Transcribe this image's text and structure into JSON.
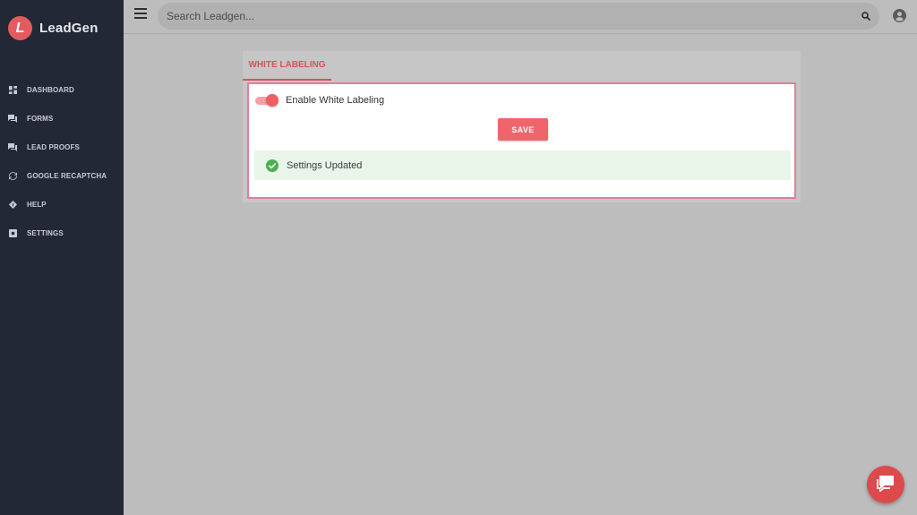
{
  "brand": {
    "logo_letter": "L",
    "name": "LeadGen",
    "color": "#e25c5f"
  },
  "sidebar": {
    "items": [
      {
        "label": "DASHBOARD",
        "icon": "dashboard-icon"
      },
      {
        "label": "FORMS",
        "icon": "forms-icon"
      },
      {
        "label": "LEAD PROOFS",
        "icon": "lead-proofs-icon"
      },
      {
        "label": "GOOGLE RECAPTCHA",
        "icon": "recaptcha-icon"
      },
      {
        "label": "HELP",
        "icon": "help-icon"
      },
      {
        "label": "SETTINGS",
        "icon": "settings-icon"
      }
    ]
  },
  "header": {
    "menu_icon": "hamburger-menu-icon",
    "search_placeholder": "Search Leadgen...",
    "search_value": "",
    "search_icon": "search-icon",
    "user_icon": "user-account-icon"
  },
  "main": {
    "tabs": [
      {
        "label": "WHITE LABELING",
        "active": true
      }
    ],
    "toggle": {
      "label": "Enable White Labeling",
      "enabled": true
    },
    "save_label": "SAVE",
    "alert": {
      "icon": "check-circle-icon",
      "text": "Settings Updated",
      "color": "#4caf50"
    }
  },
  "chat": {
    "icon": "chat-bubble-icon"
  },
  "colors": {
    "accent": "#f0656b",
    "sidebar_bg": "#222836",
    "tab_active": "#d9525a"
  }
}
